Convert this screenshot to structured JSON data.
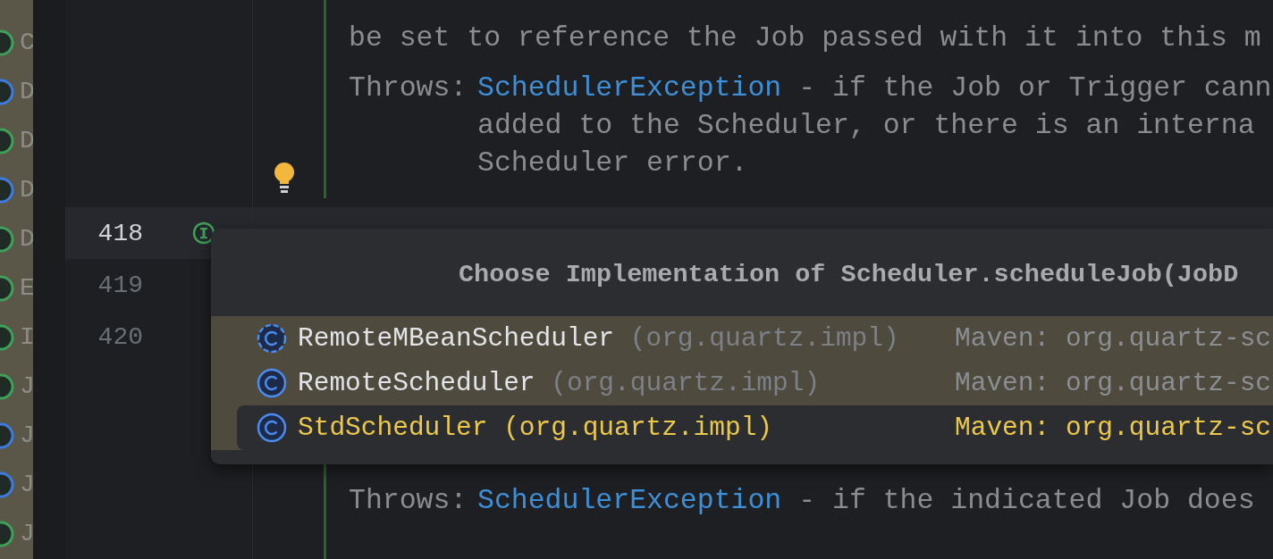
{
  "project_panel": {
    "items": [
      {
        "letter": "C",
        "color": "#3fa05a"
      },
      {
        "letter": "D",
        "color": "#3d7be0"
      },
      {
        "letter": "D",
        "color": "#3fa05a"
      },
      {
        "letter": "D",
        "color": "#3d7be0"
      },
      {
        "letter": "D",
        "color": "#3fa05a"
      },
      {
        "letter": "E",
        "color": "#3fa05a"
      },
      {
        "letter": "I",
        "color": "#3fa05a"
      },
      {
        "letter": "J",
        "color": "#3fa05a"
      },
      {
        "letter": "J",
        "color": "#3d7be0"
      },
      {
        "letter": "J",
        "color": "#3d7be0"
      },
      {
        "letter": "J",
        "color": "#3fa05a"
      }
    ]
  },
  "editor": {
    "doc_top": {
      "paragraph": [
        "be set to reference the Job passed with it into this m"
      ],
      "throws": {
        "label": "Throws:",
        "exception": "SchedulerException",
        "lines": [
          " - if the Job or Trigger cann",
          "added to the Scheduler, or there is an interna",
          "Scheduler error."
        ]
      }
    },
    "lines": [
      {
        "number": "418",
        "current": true
      },
      {
        "number": "419",
        "current": false
      },
      {
        "number": "420",
        "current": false
      }
    ],
    "doc_bottom": {
      "throws": {
        "label": "Throws:",
        "exception": "SchedulerException",
        "lines": [
          " - if the indicated Job does"
        ]
      }
    }
  },
  "popup": {
    "title": "Choose Implementation of Scheduler.scheduleJob(JobD",
    "items": [
      {
        "name": "RemoteMBeanScheduler",
        "package": "(org.quartz.impl)",
        "location": "Maven: org.quartz-sc",
        "kind": "abstract_class",
        "selected": false
      },
      {
        "name": "RemoteScheduler",
        "package": "(org.quartz.impl)",
        "location": "Maven: org.quartz-sc",
        "kind": "class",
        "selected": false
      },
      {
        "name": "StdScheduler",
        "package": "(org.quartz.impl)",
        "location": "Maven: org.quartz-sc",
        "kind": "class",
        "selected": true
      }
    ]
  }
}
